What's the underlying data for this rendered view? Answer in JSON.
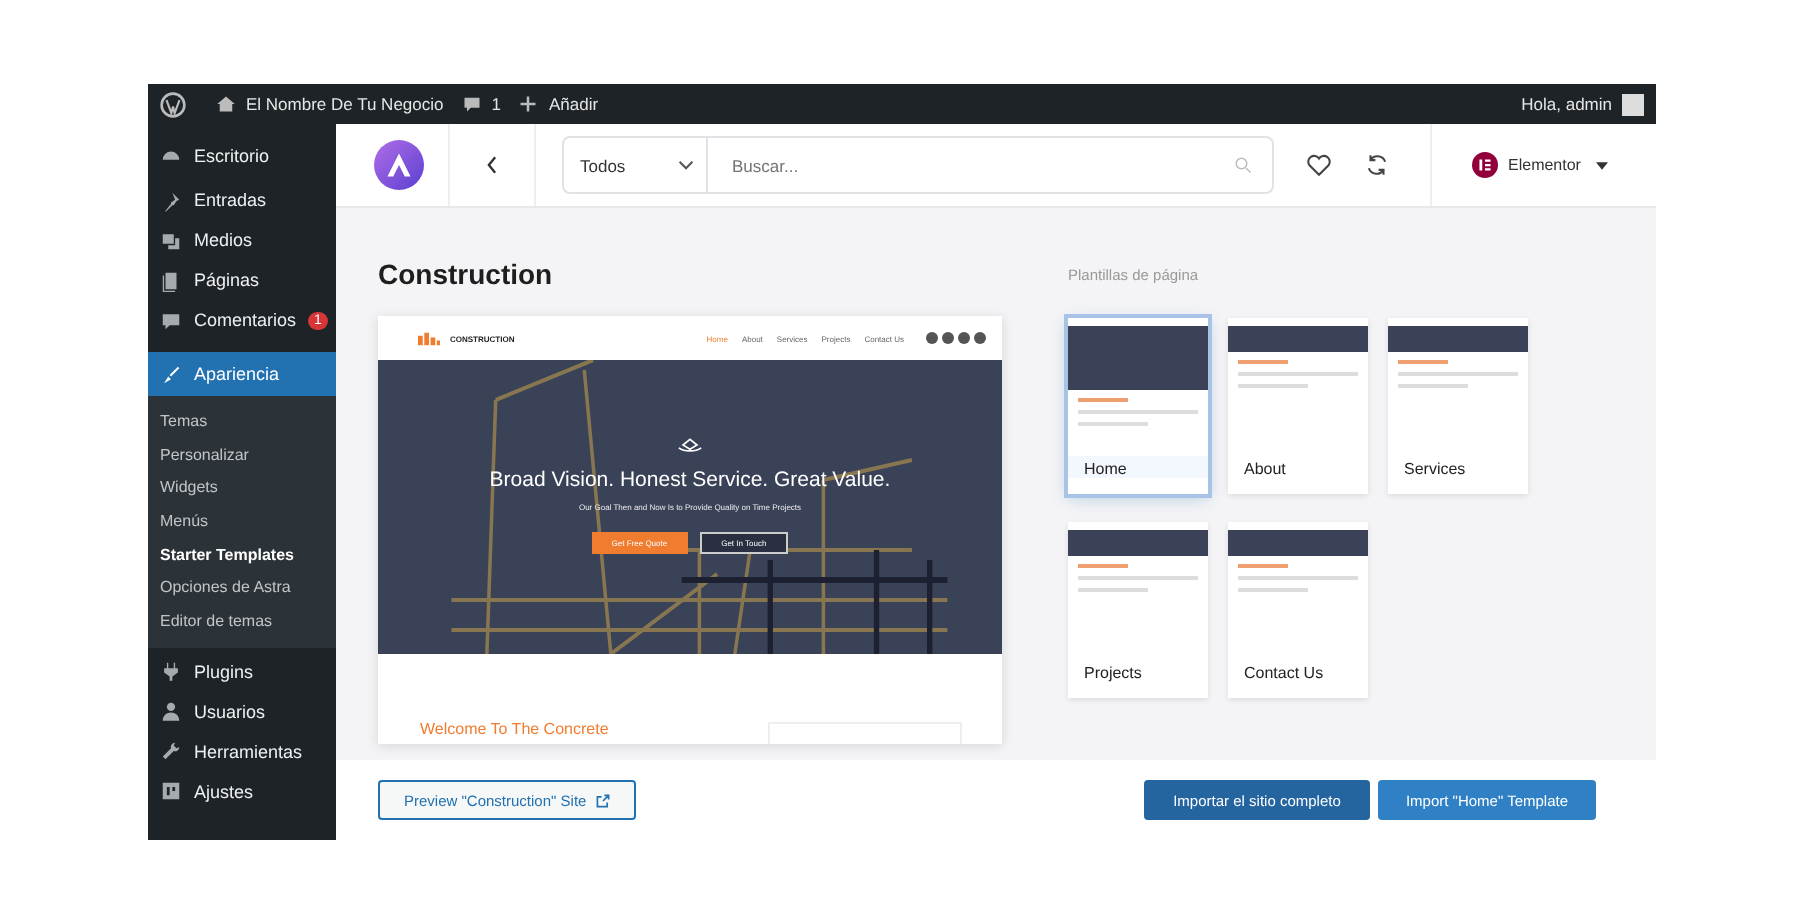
{
  "admin_bar": {
    "site_name": "El Nombre De Tu Negocio",
    "comments": "1",
    "new": "Añadir",
    "greeting": "Hola, admin"
  },
  "sidebar": {
    "items": [
      {
        "label": "Escritorio",
        "selected": false
      },
      {
        "label": "Entradas",
        "selected": false
      },
      {
        "label": "Medios",
        "selected": false
      },
      {
        "label": "Páginas",
        "selected": false
      },
      {
        "label": "Comentarios",
        "selected": false,
        "badge": "1"
      },
      {
        "label": "Apariencia",
        "selected": true,
        "children": [
          {
            "label": "Temas",
            "selected": false
          },
          {
            "label": "Personalizar",
            "selected": false
          },
          {
            "label": "Widgets",
            "selected": false
          },
          {
            "label": "Menús",
            "selected": false
          },
          {
            "label": "Starter Templates",
            "selected": true
          },
          {
            "label": "Opciones de Astra",
            "selected": false
          },
          {
            "label": "Editor de temas",
            "selected": false
          }
        ]
      },
      {
        "label": "Plugins",
        "selected": false
      },
      {
        "label": "Usuarios",
        "selected": false
      },
      {
        "label": "Herramientas",
        "selected": false
      },
      {
        "label": "Ajustes",
        "selected": false
      }
    ]
  },
  "toolbar": {
    "filter": "Todos",
    "search_placeholder": "Buscar...",
    "builder": "Elementor"
  },
  "template": {
    "title": "Construction",
    "preview": {
      "logo": "CONSTRUCTION",
      "nav": [
        {
          "label": "Home",
          "selected": true
        },
        {
          "label": "About",
          "selected": false
        },
        {
          "label": "Services",
          "selected": false
        },
        {
          "label": "Projects",
          "selected": false
        },
        {
          "label": "Contact Us",
          "selected": false
        }
      ],
      "headline": "Broad Vision. Honest Service. Great Value.",
      "subline": "Our Goal Then and Now Is to Provide Quality on Time Projects",
      "primary_button": "Get Free Quote",
      "secondary_button": "Get In Touch",
      "welcome": "Welcome To The Concrete"
    }
  },
  "page_templates": {
    "heading": "Plantillas de página",
    "items": [
      {
        "label": "Home",
        "selected": true
      },
      {
        "label": "About",
        "selected": false
      },
      {
        "label": "Services",
        "selected": false
      },
      {
        "label": "Projects",
        "selected": false
      },
      {
        "label": "Contact Us",
        "selected": false
      }
    ]
  },
  "footer": {
    "preview_button": "Preview \"Construction\" Site",
    "import_site_button": "Importar el sitio completo",
    "import_page_button": "Import \"Home\" Template"
  }
}
